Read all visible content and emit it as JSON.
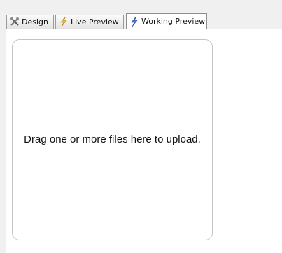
{
  "tabs": [
    {
      "label": "Design",
      "icon": "design-tools-icon",
      "active": false
    },
    {
      "label": "Live Preview",
      "icon": "lightning-icon",
      "active": false
    },
    {
      "label": "Working Preview",
      "icon": "lightning-blue-icon",
      "active": true
    }
  ],
  "dropzone": {
    "message": "Drag one or more files here to upload."
  },
  "colors": {
    "lightning_yellow": "#f2b632",
    "lightning_blue": "#4a73d9",
    "background": "#f0f0f0",
    "panel": "#ffffff"
  }
}
